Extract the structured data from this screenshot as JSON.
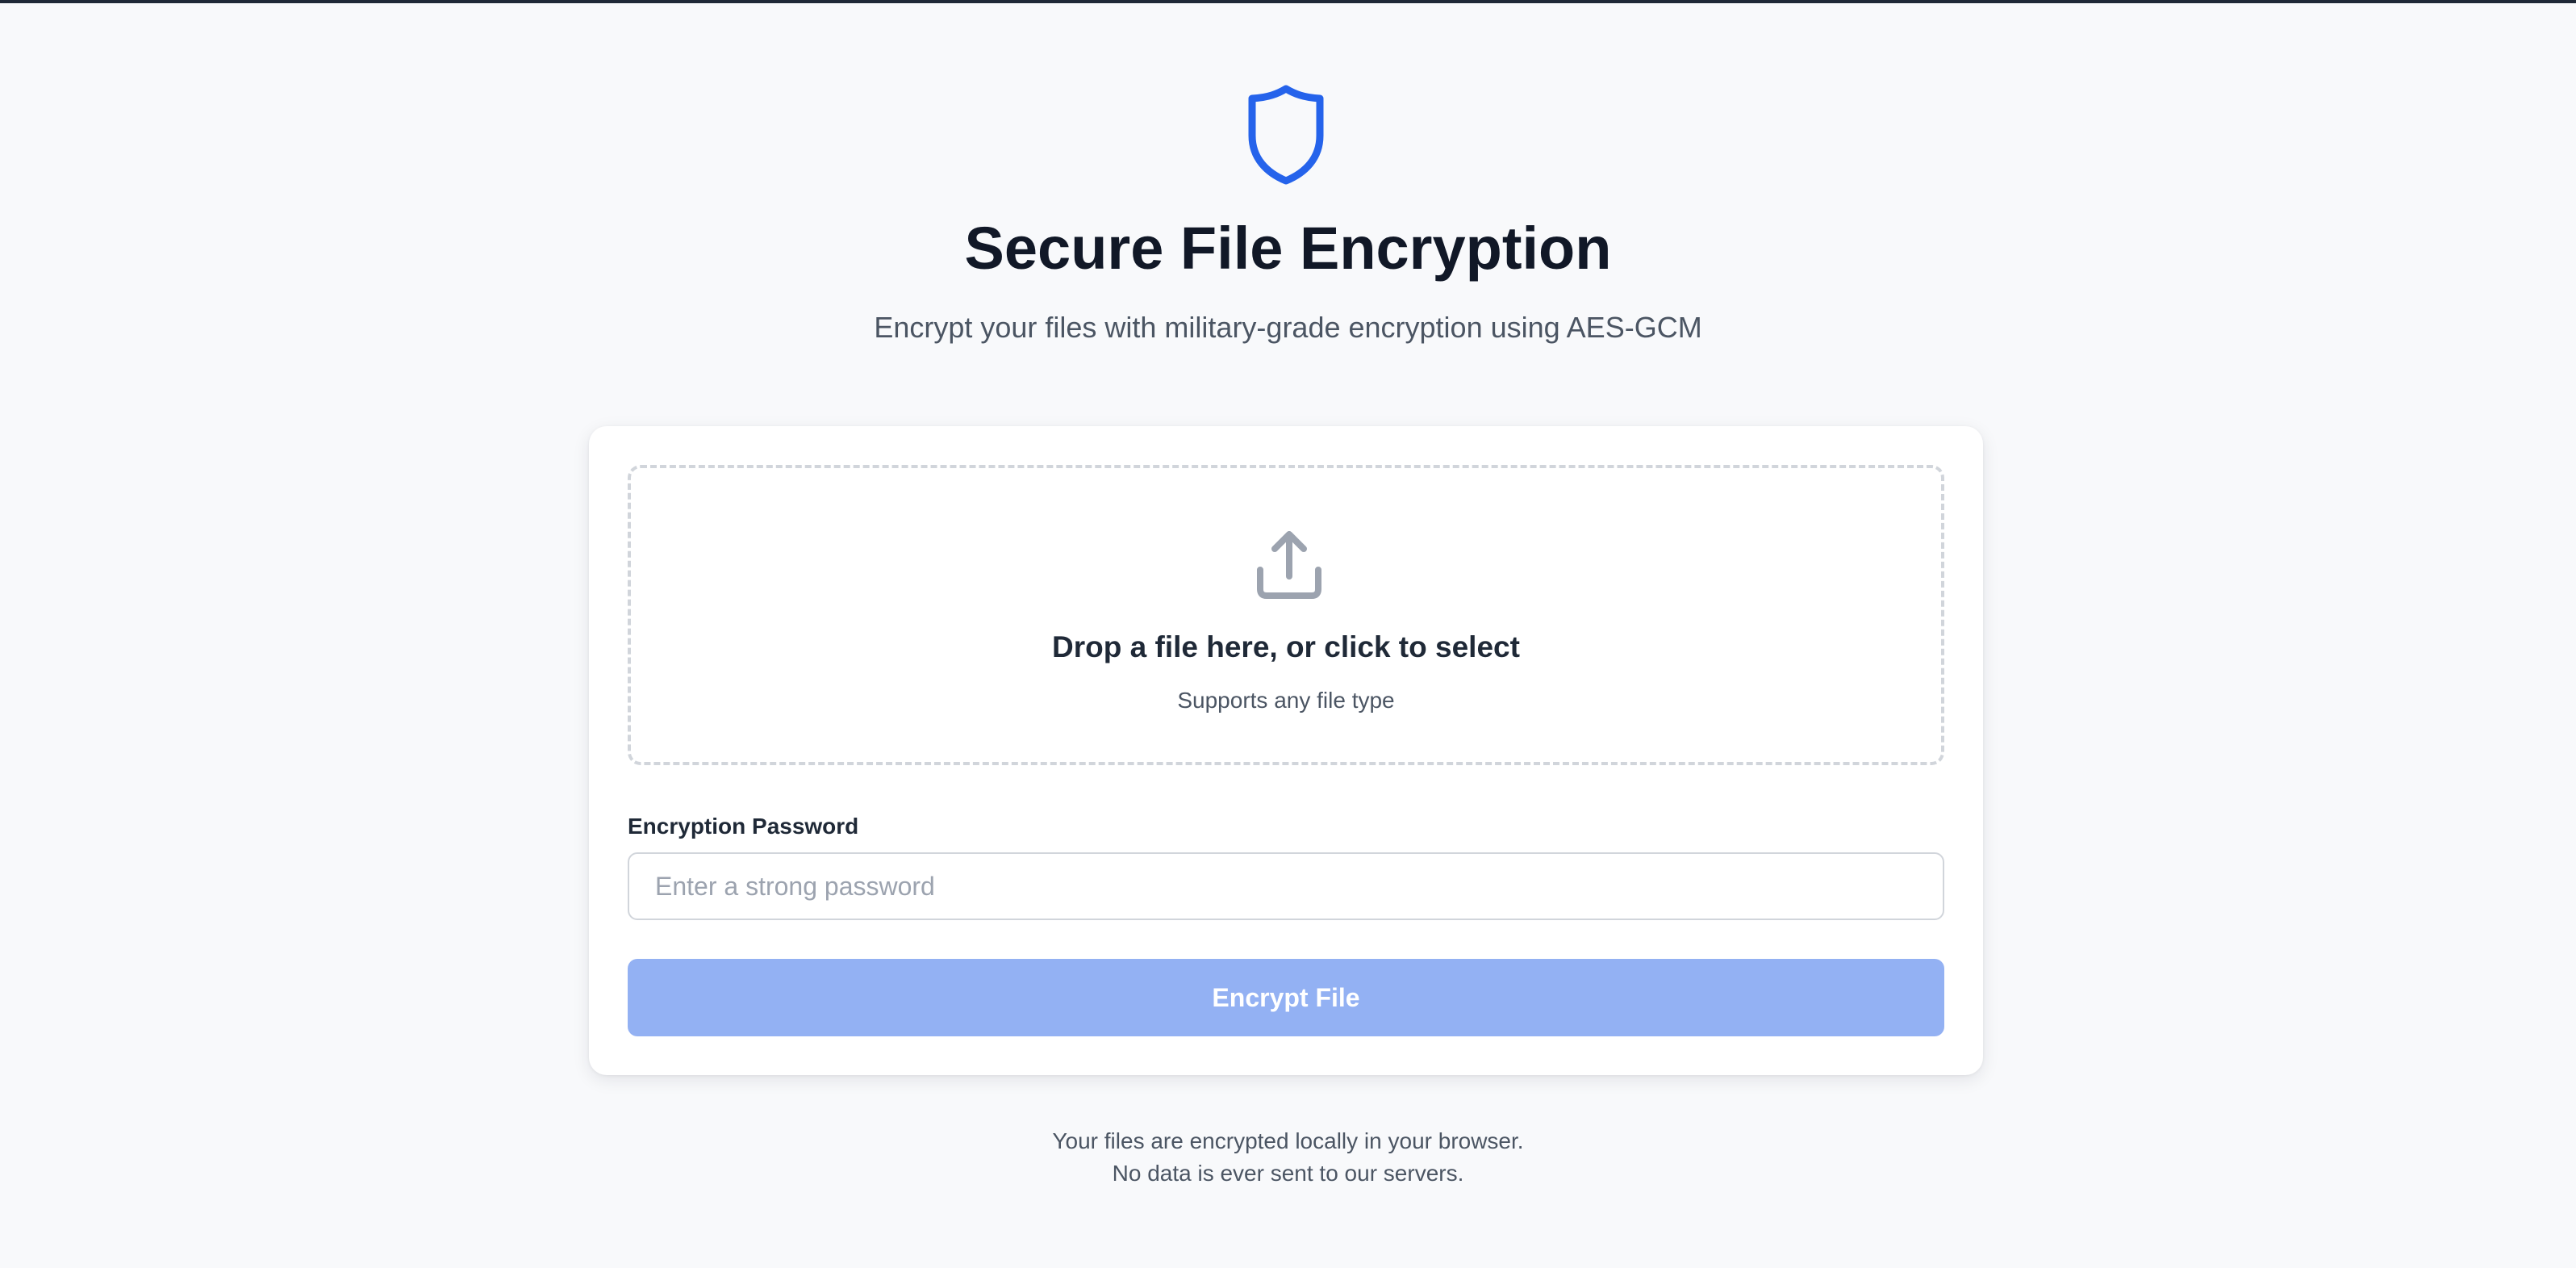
{
  "header": {
    "icon": "shield-icon",
    "title": "Secure File Encryption",
    "subtitle": "Encrypt your files with military-grade encryption using AES-GCM"
  },
  "dropzone": {
    "icon": "upload-icon",
    "title": "Drop a file here, or click to select",
    "subtitle": "Supports any file type"
  },
  "password": {
    "label": "Encryption Password",
    "value": "",
    "placeholder": "Enter a strong password"
  },
  "encrypt_button": {
    "label": "Encrypt File",
    "state": "disabled"
  },
  "footer": {
    "line1": "Your files are encrypted locally in your browser.",
    "line2": "No data is ever sent to our servers."
  },
  "colors": {
    "accent": "#2563eb",
    "button_disabled": "#93b1f3",
    "background": "#f8f9fb"
  }
}
